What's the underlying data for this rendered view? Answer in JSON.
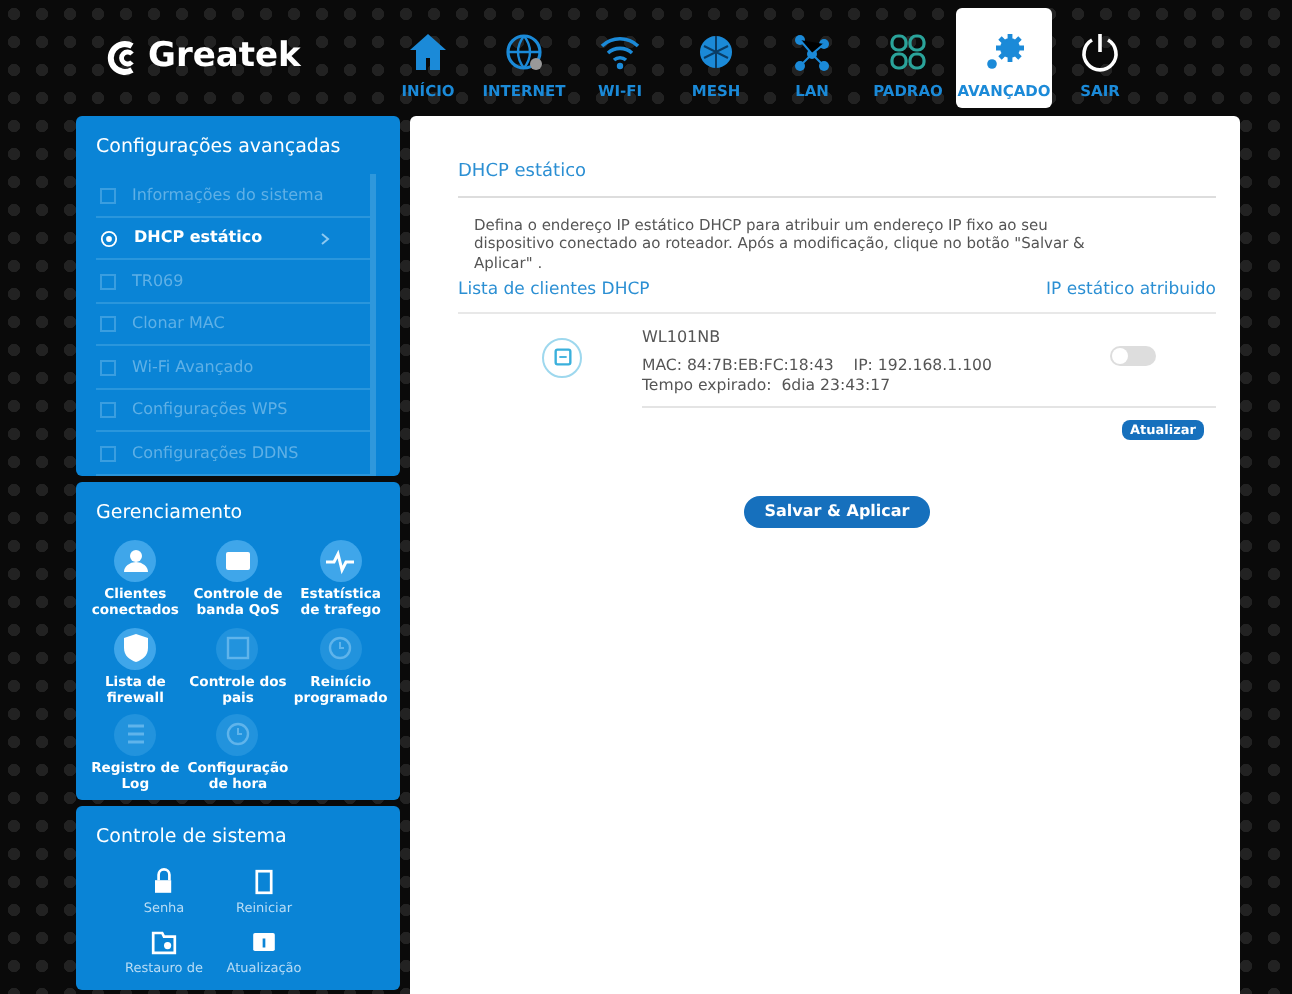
{
  "header": {
    "logo": "Greatek",
    "nav": [
      {
        "label": "INÍCIO",
        "kind": "home",
        "selected": false
      },
      {
        "label": "INTERNET",
        "kind": "globe",
        "selected": false
      },
      {
        "label": "WI-FI",
        "kind": "wifi",
        "selected": false
      },
      {
        "label": "MESH",
        "kind": "mesh",
        "selected": false
      },
      {
        "label": "LAN",
        "kind": "lan",
        "selected": false
      },
      {
        "label": "PADRAO",
        "kind": "grid",
        "selected": false
      },
      {
        "label": "AVANÇADO",
        "kind": "gear",
        "selected": true
      },
      {
        "label": "SAIR",
        "kind": "power",
        "selected": false
      }
    ]
  },
  "sidebar": {
    "advanced": {
      "title": "Configurações avançadas",
      "items": [
        {
          "label": "Informações do sistema",
          "selected": false
        },
        {
          "label": "DHCP estático",
          "selected": true
        },
        {
          "label": "TR069",
          "selected": false
        },
        {
          "label": "Clonar MAC",
          "selected": false
        },
        {
          "label": "Wi-Fi Avançado",
          "selected": false
        },
        {
          "label": "Configurações WPS",
          "selected": false
        },
        {
          "label": "Configurações DDNS",
          "selected": false
        }
      ]
    },
    "management": {
      "title": "Gerenciamento",
      "items": [
        {
          "label": "Clientes conectados",
          "kind": "user",
          "dimmed": false
        },
        {
          "label": "Controle de banda QoS",
          "kind": "qos",
          "dimmed": false
        },
        {
          "label": "Estatística de trafego",
          "kind": "pulse",
          "dimmed": false
        },
        {
          "label": "Lista de firewall",
          "kind": "shield",
          "dimmed": false
        },
        {
          "label": "Controle dos pais",
          "kind": "calendar",
          "dimmed": true
        },
        {
          "label": "Reinício programado",
          "kind": "clock",
          "dimmed": true
        },
        {
          "label": "Registro de Log",
          "kind": "list",
          "dimmed": true
        },
        {
          "label": "Configuração de hora",
          "kind": "clock",
          "dimmed": true
        }
      ]
    },
    "system": {
      "title": "Controle de sistema",
      "items": [
        {
          "label": "Senha",
          "kind": "lock",
          "disabled": true
        },
        {
          "label": "Reiniciar",
          "kind": "device",
          "disabled": true
        },
        {
          "label": "Restauro de",
          "kind": "folder",
          "disabled": true
        },
        {
          "label": "Atualização",
          "kind": "box",
          "disabled": true
        }
      ]
    }
  },
  "content": {
    "title": "DHCP estático",
    "description": "Defina o endereço IP estático DHCP para atribuir um endereço IP fixo ao seu dispositivo conectado ao roteador. Após a modificação, clique no botão \"Salvar & Aplicar\" .",
    "list_title": "Lista de clientes DHCP",
    "column_right": "IP estático atribuido",
    "clients": [
      {
        "name": "WL101NB",
        "details": "MAC: 84:7B:EB:FC:18:43    IP: 192.168.1.100    Tempo expirado:  6dia 23:43:17",
        "on": false
      }
    ],
    "refresh_button": "Atualizar",
    "save_button": "Salvar & Aplicar"
  }
}
